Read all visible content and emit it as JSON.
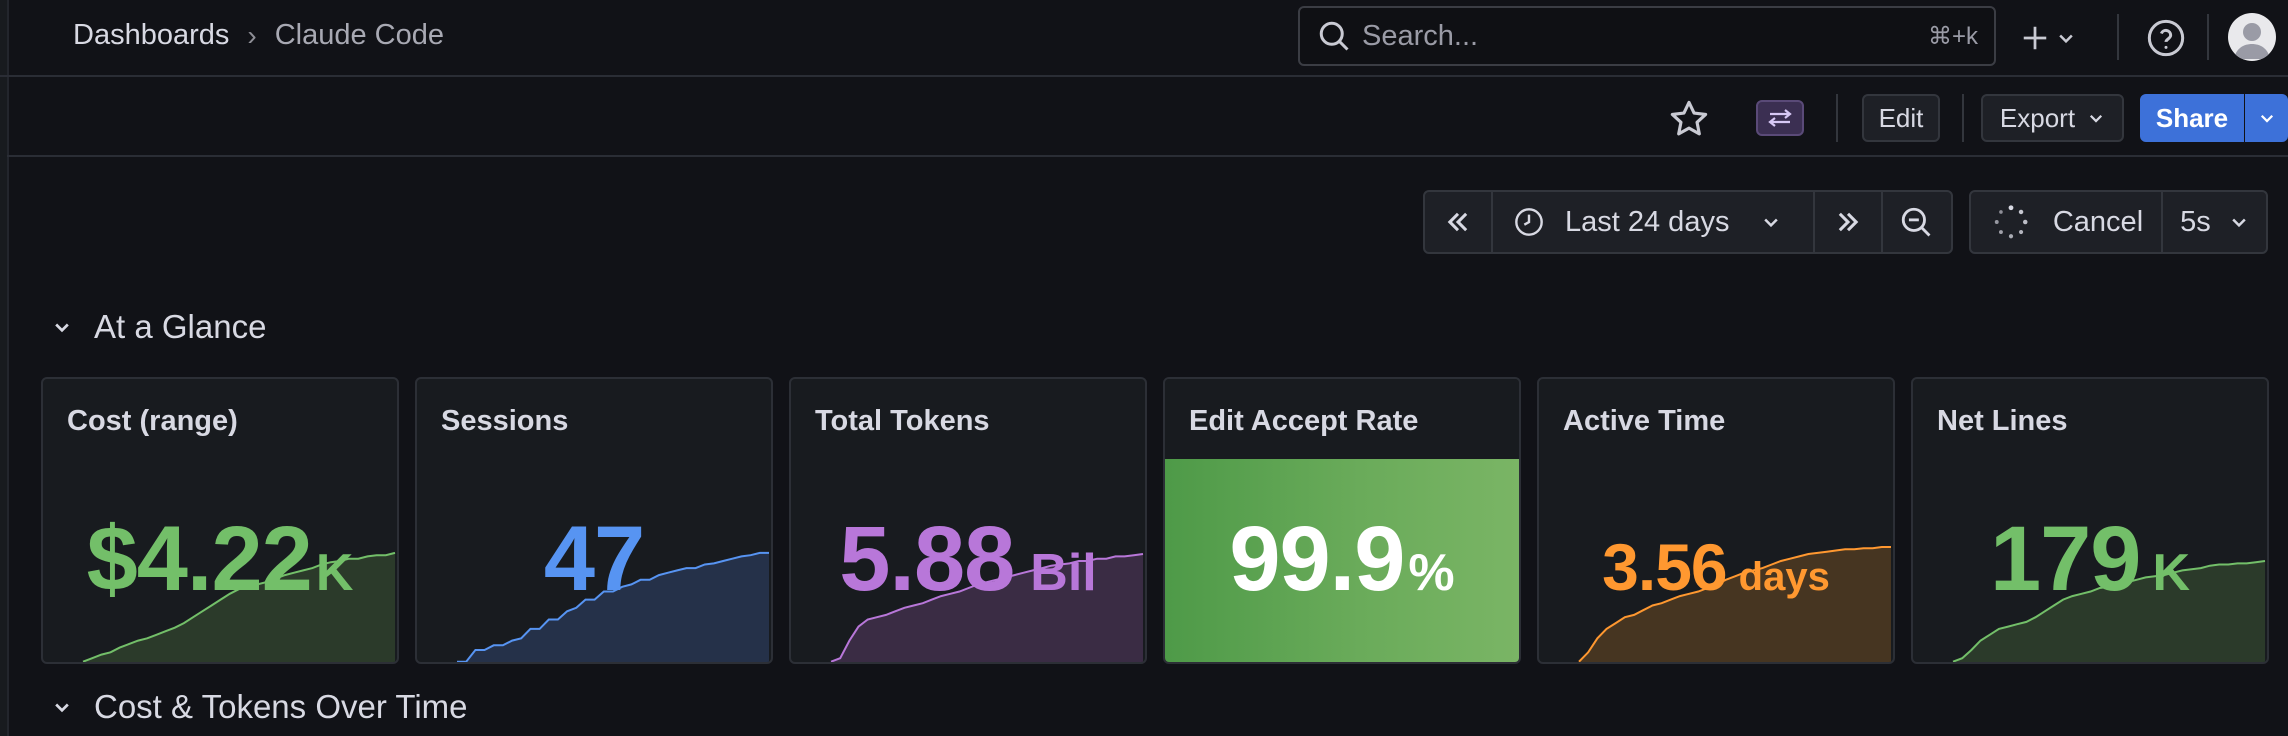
{
  "breadcrumb": {
    "root": "Dashboards",
    "current": "Claude Code"
  },
  "search": {
    "placeholder": "Search...",
    "shortcut": "⌘+k"
  },
  "toolbar": {
    "edit": "Edit",
    "export": "Export",
    "share": "Share"
  },
  "time": {
    "range": "Last 24 days",
    "cancel": "Cancel",
    "refresh": "5s"
  },
  "sections": {
    "glance": "At a Glance",
    "cost_tokens": "Cost & Tokens Over Time"
  },
  "colors": {
    "green": "#73bf69",
    "blue": "#5794f2",
    "purple": "#b877d9",
    "orange": "#ff9830",
    "share": "#3d71d9"
  },
  "panels": [
    {
      "title": "Cost (range)",
      "value": "$4.22",
      "unit": "K",
      "color": "#73bf69",
      "fill": "#2b3a2a",
      "spark": [
        0.02,
        0.05,
        0.08,
        0.1,
        0.14,
        0.17,
        0.2,
        0.22,
        0.25,
        0.28,
        0.31,
        0.35,
        0.4,
        0.45,
        0.5,
        0.55,
        0.6,
        0.64,
        0.66,
        0.68,
        0.7,
        0.73,
        0.76,
        0.78,
        0.8,
        0.82,
        0.85,
        0.87,
        0.88,
        0.9,
        0.9,
        0.92,
        0.93,
        0.93,
        0.95
      ]
    },
    {
      "title": "Sessions",
      "value": "47",
      "unit": "",
      "color": "#5794f2",
      "fill": "#253149",
      "spark": [
        0.02,
        0.02,
        0.12,
        0.12,
        0.16,
        0.16,
        0.2,
        0.22,
        0.3,
        0.3,
        0.38,
        0.38,
        0.45,
        0.48,
        0.55,
        0.55,
        0.62,
        0.62,
        0.66,
        0.68,
        0.72,
        0.72,
        0.76,
        0.78,
        0.8,
        0.82,
        0.82,
        0.85,
        0.86,
        0.88,
        0.9,
        0.92,
        0.93,
        0.95,
        0.95
      ]
    },
    {
      "title": "Total Tokens",
      "value": "5.88",
      "unit": "Bil",
      "color": "#b877d9",
      "fill": "#3a2c44",
      "spark": [
        0.02,
        0.05,
        0.2,
        0.32,
        0.38,
        0.4,
        0.42,
        0.45,
        0.48,
        0.5,
        0.52,
        0.55,
        0.58,
        0.6,
        0.62,
        0.65,
        0.68,
        0.7,
        0.72,
        0.74,
        0.76,
        0.78,
        0.8,
        0.82,
        0.84,
        0.85,
        0.86,
        0.88,
        0.88,
        0.9,
        0.9,
        0.92,
        0.92,
        0.93,
        0.94
      ]
    },
    {
      "title": "Edit Accept Rate",
      "value": "99.9",
      "unit": "%",
      "color": "#ffffff",
      "fill": "",
      "spark": []
    },
    {
      "title": "Active Time",
      "value": "3.56",
      "unit": "days",
      "color": "#ff9830",
      "fill": "#463521",
      "spark": [
        0.02,
        0.1,
        0.22,
        0.3,
        0.35,
        0.4,
        0.42,
        0.46,
        0.5,
        0.52,
        0.55,
        0.58,
        0.6,
        0.62,
        0.65,
        0.68,
        0.72,
        0.75,
        0.78,
        0.8,
        0.82,
        0.85,
        0.88,
        0.9,
        0.92,
        0.94,
        0.95,
        0.96,
        0.97,
        0.98,
        0.98,
        0.99,
        0.99,
        1.0,
        1.0
      ]
    },
    {
      "title": "Net Lines",
      "value": "179",
      "unit": "K",
      "color": "#73bf69",
      "fill": "#2b3a2a",
      "spark": [
        0.02,
        0.05,
        0.12,
        0.2,
        0.25,
        0.3,
        0.32,
        0.34,
        0.36,
        0.4,
        0.45,
        0.5,
        0.55,
        0.58,
        0.6,
        0.62,
        0.65,
        0.66,
        0.68,
        0.7,
        0.72,
        0.74,
        0.75,
        0.76,
        0.78,
        0.8,
        0.81,
        0.82,
        0.84,
        0.85,
        0.85,
        0.86,
        0.86,
        0.87,
        0.88
      ]
    }
  ]
}
